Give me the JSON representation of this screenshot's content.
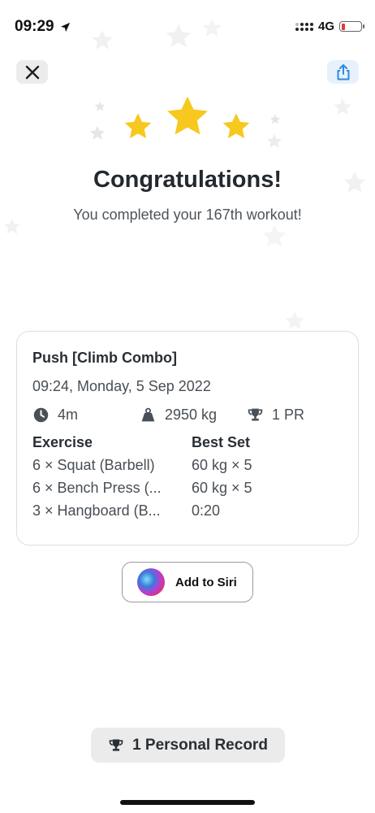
{
  "status_bar": {
    "time": "09:29",
    "network": "4G",
    "battery_level": 0.1
  },
  "header": {
    "close_icon": "close-icon",
    "share_icon": "share-icon",
    "title": "Congratulations!",
    "subtitle": "You completed your 167th workout!"
  },
  "rating": {
    "stars": 3,
    "star_color": "#f7c81e"
  },
  "workout": {
    "name": "Push [Climb Combo]",
    "date": "09:24, Monday, 5 Sep 2022",
    "duration": "4m",
    "volume": "2950 kg",
    "prs": "1 PR",
    "columns": {
      "exercise": "Exercise",
      "best_set": "Best Set"
    },
    "exercises": [
      {
        "name": "6 × Squat (Barbell)",
        "best_set": "60 kg × 5"
      },
      {
        "name": "6 × Bench Press (...",
        "best_set": "60 kg × 5"
      },
      {
        "name": "3 × Hangboard (B...",
        "best_set": "0:20"
      }
    ]
  },
  "siri": {
    "label": "Add to Siri"
  },
  "footer": {
    "personal_records": "1 Personal Record"
  },
  "colors": {
    "accent_blue": "#2f8ae0",
    "star_yellow": "#f7c81e",
    "text_dark": "#23292f"
  }
}
